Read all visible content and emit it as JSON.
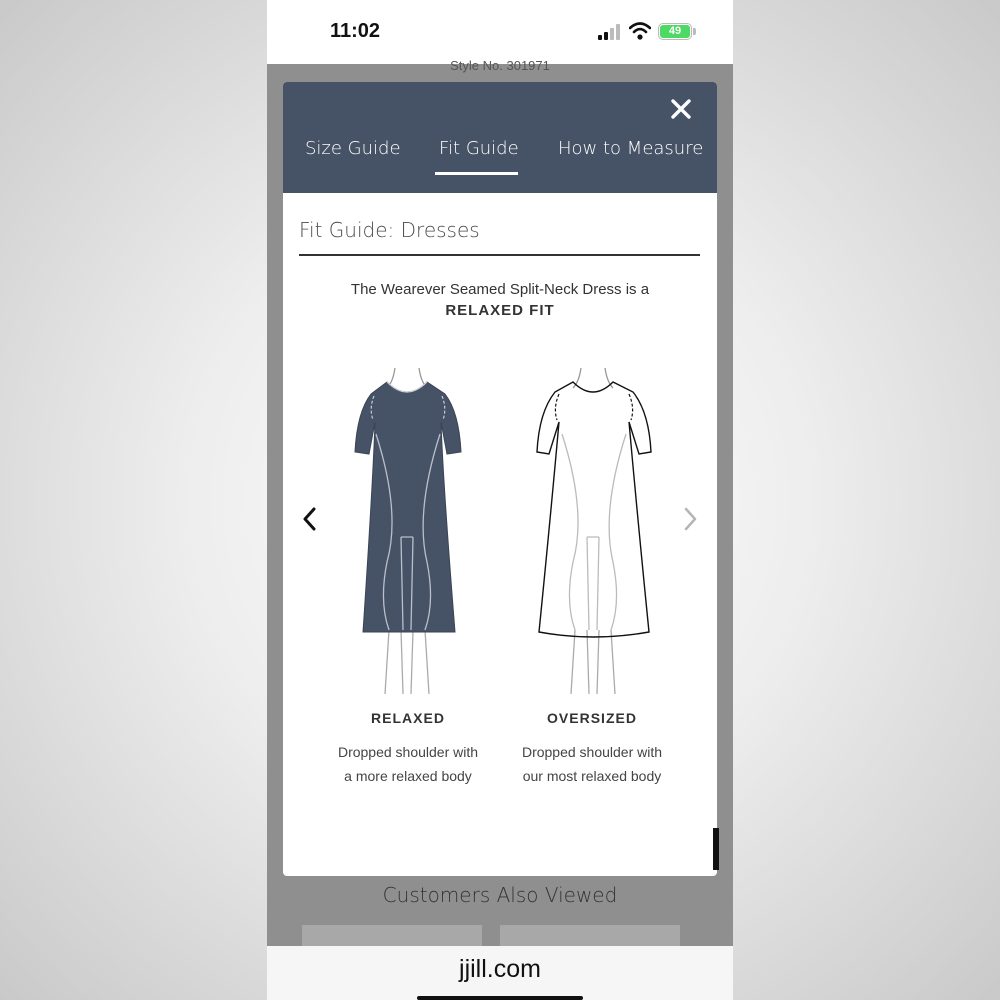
{
  "status_bar": {
    "time": "11:02",
    "battery": "49"
  },
  "background_page": {
    "style_no": "Style No. 301971",
    "section_title": "Customers Also Viewed"
  },
  "modal": {
    "tabs": [
      {
        "label": "Size Guide",
        "active": false
      },
      {
        "label": "Fit Guide",
        "active": true
      },
      {
        "label": "How to Measure",
        "active": false
      }
    ],
    "title": "Fit Guide: Dresses",
    "description_line1": "The Wearever Seamed Split-Neck Dress is a",
    "description_line2": "RELAXED FIT",
    "fits": [
      {
        "name": "RELAXED",
        "desc_line1": "Dropped shoulder with",
        "desc_line2": "a more relaxed body",
        "selected": true
      },
      {
        "name": "OVERSIZED",
        "desc_line1": "Dropped shoulder with",
        "desc_line2": "our most relaxed body",
        "selected": false
      }
    ]
  },
  "browser": {
    "url": "jjill.com"
  },
  "colors": {
    "header_bg": "#465265",
    "overlay": "#8f8f8f",
    "dress_fill": "#465265"
  },
  "icons": {
    "close": "close-icon",
    "prev": "chevron-left-icon",
    "next": "chevron-right-icon"
  }
}
